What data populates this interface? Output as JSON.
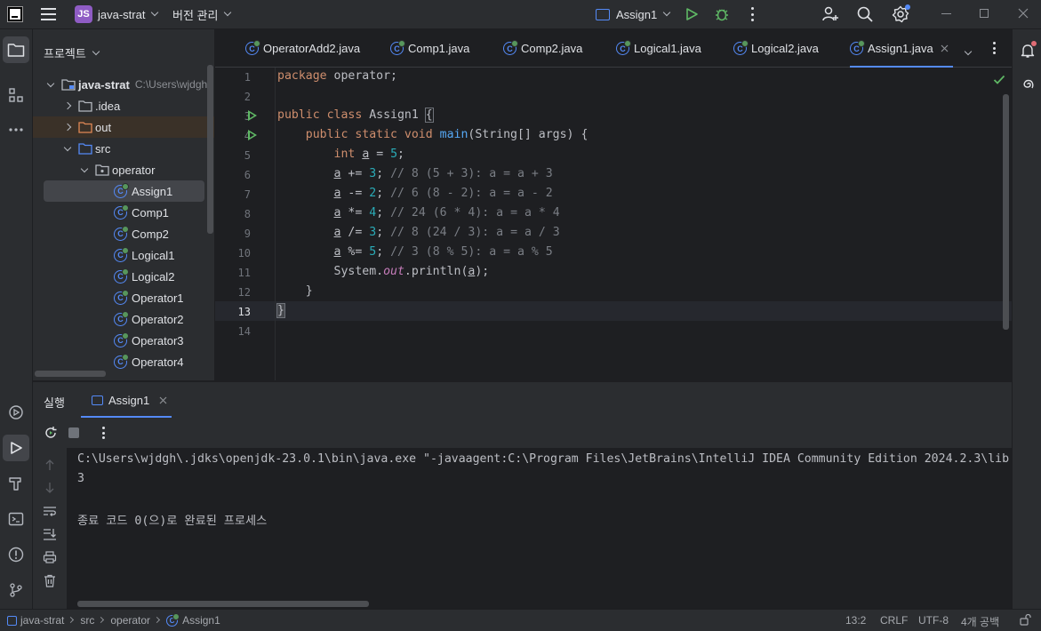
{
  "titlebar": {
    "project_badge": "JS",
    "project_name": "java-strat",
    "vcs_label": "버전 관리",
    "run_config": "Assign1"
  },
  "project_panel": {
    "title": "프로젝트",
    "root_name": "java-strat",
    "root_path": "C:\\Users\\wjdgh",
    "items": [
      {
        "label": ".idea"
      },
      {
        "label": "out"
      },
      {
        "label": "src"
      },
      {
        "label": "operator"
      },
      {
        "label": "Assign1"
      },
      {
        "label": "Comp1"
      },
      {
        "label": "Comp2"
      },
      {
        "label": "Logical1"
      },
      {
        "label": "Logical2"
      },
      {
        "label": "Operator1"
      },
      {
        "label": "Operator2"
      },
      {
        "label": "Operator3"
      },
      {
        "label": "Operator4"
      }
    ]
  },
  "tabs": [
    {
      "label": "OperatorAdd2.java"
    },
    {
      "label": "Comp1.java"
    },
    {
      "label": "Comp2.java"
    },
    {
      "label": "Logical1.java"
    },
    {
      "label": "Logical2.java"
    },
    {
      "label": "Assign1.java",
      "active": true
    }
  ],
  "editor": {
    "line_numbers": [
      "1",
      "2",
      "3",
      "4",
      "5",
      "6",
      "7",
      "8",
      "9",
      "10",
      "11",
      "12",
      "13",
      "14"
    ],
    "current_line": 13
  },
  "run_panel": {
    "title": "실행",
    "tab_label": "Assign1",
    "console_lines": [
      "C:\\Users\\wjdgh\\.jdks\\openjdk-23.0.1\\bin\\java.exe \"-javaagent:C:\\Program Files\\JetBrains\\IntelliJ IDEA Community Edition 2024.2.3\\lib",
      "3",
      "",
      "종료 코드 0(으)로 완료된 프로세스"
    ]
  },
  "status_bar": {
    "breadcrumbs": [
      "java-strat",
      "src",
      "operator",
      "Assign1"
    ],
    "position": "13:2",
    "line_separator": "CRLF",
    "encoding": "UTF-8",
    "indent": "4개 공백"
  },
  "colors": {
    "accent": "#548af7",
    "run_green": "#5fb865",
    "keyword": "#cf8e6d",
    "number": "#2aacb8",
    "comment": "#7a7e85",
    "function": "#56a8f5",
    "static_field": "#c77dbb"
  }
}
